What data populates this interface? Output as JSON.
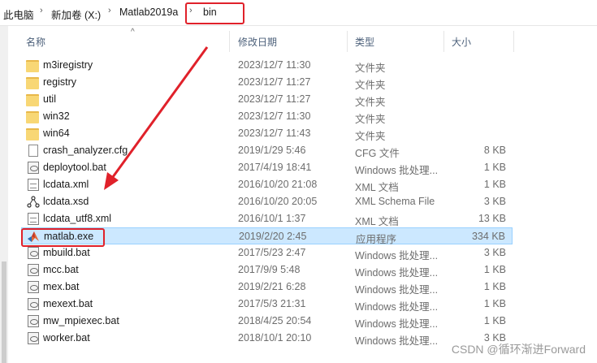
{
  "breadcrumb": {
    "items": [
      "此电脑",
      "新加卷 (X:)",
      "Matlab2019a",
      "bin"
    ]
  },
  "columns": {
    "name": "名称",
    "modified": "修改日期",
    "type": "类型",
    "size": "大小"
  },
  "files": [
    {
      "name": "m3iregistry",
      "date": "2023/12/7 11:30",
      "type": "文件夹",
      "size": "",
      "icon": "folder-icon"
    },
    {
      "name": "registry",
      "date": "2023/12/7 11:27",
      "type": "文件夹",
      "size": "",
      "icon": "folder-icon"
    },
    {
      "name": "util",
      "date": "2023/12/7 11:27",
      "type": "文件夹",
      "size": "",
      "icon": "folder-icon"
    },
    {
      "name": "win32",
      "date": "2023/12/7 11:30",
      "type": "文件夹",
      "size": "",
      "icon": "folder-icon"
    },
    {
      "name": "win64",
      "date": "2023/12/7 11:43",
      "type": "文件夹",
      "size": "",
      "icon": "folder-icon"
    },
    {
      "name": "crash_analyzer.cfg",
      "date": "2019/1/29 5:46",
      "type": "CFG 文件",
      "size": "8 KB",
      "icon": "file-icon"
    },
    {
      "name": "deploytool.bat",
      "date": "2017/4/19 18:41",
      "type": "Windows 批处理...",
      "size": "1 KB",
      "icon": "batch-file-icon"
    },
    {
      "name": "lcdata.xml",
      "date": "2016/10/20 21:08",
      "type": "XML 文档",
      "size": "1 KB",
      "icon": "xml-file-icon"
    },
    {
      "name": "lcdata.xsd",
      "date": "2016/10/20 20:05",
      "type": "XML Schema File",
      "size": "3 KB",
      "icon": "xsd-file-icon"
    },
    {
      "name": "lcdata_utf8.xml",
      "date": "2016/10/1 1:37",
      "type": "XML 文档",
      "size": "13 KB",
      "icon": "xml-file-icon"
    },
    {
      "name": "matlab.exe",
      "date": "2019/2/20 2:45",
      "type": "应用程序",
      "size": "334 KB",
      "icon": "matlab-logo-icon"
    },
    {
      "name": "mbuild.bat",
      "date": "2017/5/23 2:47",
      "type": "Windows 批处理...",
      "size": "3 KB",
      "icon": "batch-file-icon"
    },
    {
      "name": "mcc.bat",
      "date": "2017/9/9 5:48",
      "type": "Windows 批处理...",
      "size": "1 KB",
      "icon": "batch-file-icon"
    },
    {
      "name": "mex.bat",
      "date": "2019/2/21 6:28",
      "type": "Windows 批处理...",
      "size": "1 KB",
      "icon": "batch-file-icon"
    },
    {
      "name": "mexext.bat",
      "date": "2017/5/3 21:31",
      "type": "Windows 批处理...",
      "size": "1 KB",
      "icon": "batch-file-icon"
    },
    {
      "name": "mw_mpiexec.bat",
      "date": "2018/4/25 20:54",
      "type": "Windows 批处理...",
      "size": "1 KB",
      "icon": "batch-file-icon"
    },
    {
      "name": "worker.bat",
      "date": "2018/10/1 20:10",
      "type": "Windows 批处理...",
      "size": "3 KB",
      "icon": "batch-file-icon"
    }
  ],
  "selected_file": "matlab.exe",
  "watermark": "CSDN @循环渐进Forward",
  "colors": {
    "highlight": "#e0212a",
    "selection_bg": "#cce8ff",
    "folder": "#f8d775"
  }
}
